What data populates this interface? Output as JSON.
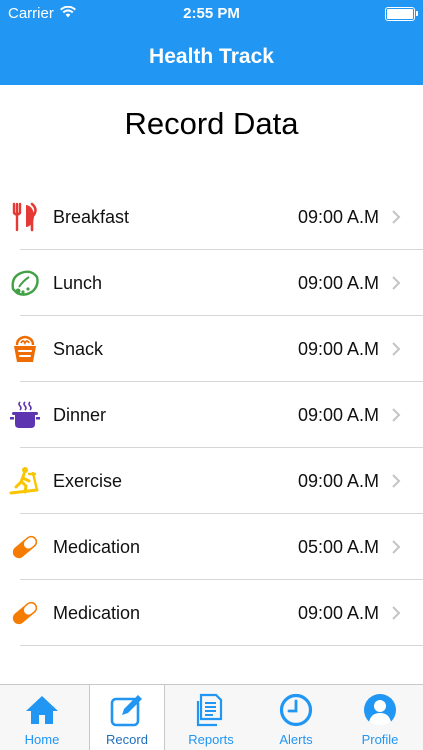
{
  "status_bar": {
    "carrier": "Carrier",
    "time": "2:55 PM"
  },
  "nav": {
    "title": "Health Track"
  },
  "page": {
    "title": "Record Data"
  },
  "colors": {
    "accent": "#2196f3",
    "breakfast": "#e53935",
    "lunch": "#43a047",
    "snack": "#ef6c00",
    "dinner": "#5e35b1",
    "exercise": "#f9c400",
    "medication": "#f57c00"
  },
  "records": [
    {
      "label": "Breakfast",
      "time": "09:00 A.M",
      "icon": "fork-knife-icon"
    },
    {
      "label": "Lunch",
      "time": "09:00 A.M",
      "icon": "lunch-icon"
    },
    {
      "label": "Snack",
      "time": "09:00 A.M",
      "icon": "snack-icon"
    },
    {
      "label": "Dinner",
      "time": "09:00 A.M",
      "icon": "pot-icon"
    },
    {
      "label": "Exercise",
      "time": "09:00 A.M",
      "icon": "treadmill-icon"
    },
    {
      "label": "Medication",
      "time": "05:00 A.M",
      "icon": "pill-icon"
    },
    {
      "label": "Medication",
      "time": "09:00 A.M",
      "icon": "pill-icon"
    }
  ],
  "tabs": [
    {
      "label": "Home",
      "icon": "home-icon"
    },
    {
      "label": "Record",
      "icon": "edit-icon"
    },
    {
      "label": "Reports",
      "icon": "reports-icon"
    },
    {
      "label": "Alerts",
      "icon": "clock-icon"
    },
    {
      "label": "Profile",
      "icon": "profile-icon"
    }
  ]
}
